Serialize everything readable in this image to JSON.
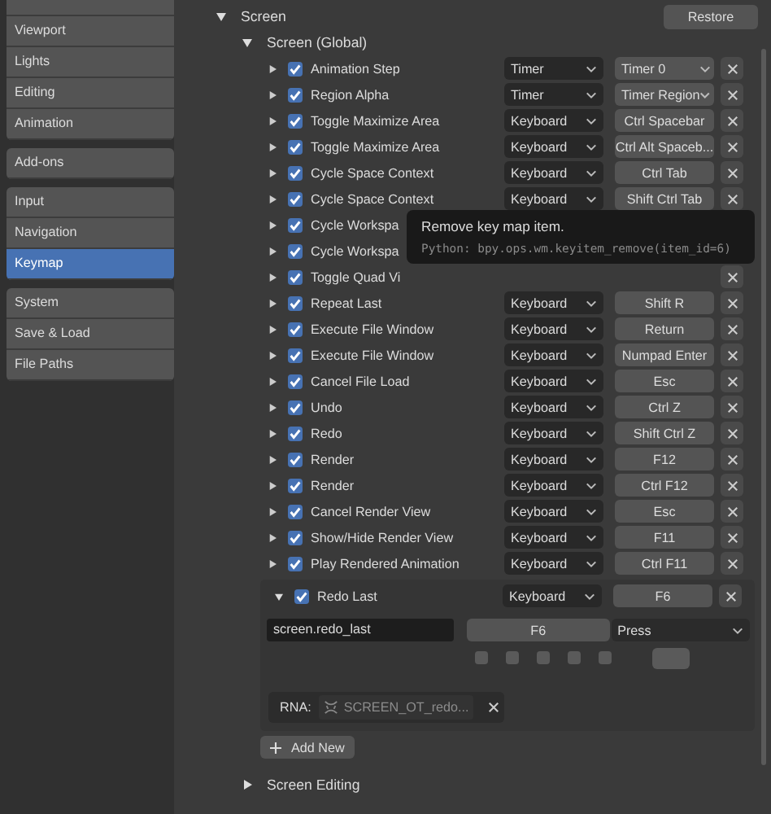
{
  "sidebar": {
    "groups": [
      [
        {
          "label": "Viewport",
          "selected": false
        },
        {
          "label": "Lights",
          "selected": false
        },
        {
          "label": "Editing",
          "selected": false
        },
        {
          "label": "Animation",
          "selected": false
        }
      ],
      [
        {
          "label": "Add-ons",
          "selected": false
        }
      ],
      [
        {
          "label": "Input",
          "selected": false
        },
        {
          "label": "Navigation",
          "selected": false
        },
        {
          "label": "Keymap",
          "selected": true
        }
      ],
      [
        {
          "label": "System",
          "selected": false
        },
        {
          "label": "Save & Load",
          "selected": false
        },
        {
          "label": "File Paths",
          "selected": false
        }
      ]
    ]
  },
  "section": {
    "title": "Screen",
    "expanded": true,
    "restore": "Restore",
    "group": {
      "title": "Screen (Global)",
      "expanded": true,
      "items": [
        {
          "name": "Animation Step",
          "checked": true,
          "type": "Timer",
          "key": "Timer 0",
          "kind": "dropdown"
        },
        {
          "name": "Region Alpha",
          "checked": true,
          "type": "Timer",
          "key": "Timer Region",
          "kind": "dropdown"
        },
        {
          "name": "Toggle Maximize Area",
          "checked": true,
          "type": "Keyboard",
          "key": "Ctrl Spacebar",
          "kind": "button"
        },
        {
          "name": "Toggle Maximize Area",
          "checked": true,
          "type": "Keyboard",
          "key": "Ctrl Alt Spaceb...",
          "kind": "button"
        },
        {
          "name": "Cycle Space Context",
          "checked": true,
          "type": "Keyboard",
          "key": "Ctrl Tab",
          "kind": "button"
        },
        {
          "name": "Cycle Space Context",
          "checked": true,
          "type": "Keyboard",
          "key": "Shift Ctrl Tab",
          "kind": "button"
        },
        {
          "name": "Cycle Workspa",
          "checked": true,
          "kind": "covered"
        },
        {
          "name": "Cycle Workspa",
          "checked": true,
          "kind": "covered"
        },
        {
          "name": "Toggle Quad Vi",
          "checked": true,
          "kind": "partial"
        },
        {
          "name": "Repeat Last",
          "checked": true,
          "type": "Keyboard",
          "key": "Shift R",
          "kind": "button"
        },
        {
          "name": "Execute File Window",
          "checked": true,
          "type": "Keyboard",
          "key": "Return",
          "kind": "button"
        },
        {
          "name": "Execute File Window",
          "checked": true,
          "type": "Keyboard",
          "key": "Numpad Enter",
          "kind": "button"
        },
        {
          "name": "Cancel File Load",
          "checked": true,
          "type": "Keyboard",
          "key": "Esc",
          "kind": "button"
        },
        {
          "name": "Undo",
          "checked": true,
          "type": "Keyboard",
          "key": "Ctrl Z",
          "kind": "button"
        },
        {
          "name": "Redo",
          "checked": true,
          "type": "Keyboard",
          "key": "Shift Ctrl Z",
          "kind": "button"
        },
        {
          "name": "Render",
          "checked": true,
          "type": "Keyboard",
          "key": "F12",
          "kind": "button"
        },
        {
          "name": "Render",
          "checked": true,
          "type": "Keyboard",
          "key": "Ctrl F12",
          "kind": "button"
        },
        {
          "name": "Cancel Render View",
          "checked": true,
          "type": "Keyboard",
          "key": "Esc",
          "kind": "button"
        },
        {
          "name": "Show/Hide Render View",
          "checked": true,
          "type": "Keyboard",
          "key": "F11",
          "kind": "button"
        },
        {
          "name": "Play Rendered Animation",
          "checked": true,
          "type": "Keyboard",
          "key": "Ctrl F11",
          "kind": "button"
        }
      ],
      "expanded_item": {
        "name": "Redo Last",
        "checked": true,
        "type": "Keyboard",
        "key": "F6",
        "operator": "screen.redo_last",
        "key_value": "F6",
        "event": "Press",
        "modifiers": [
          {
            "checked": false
          },
          {
            "checked": false
          },
          {
            "checked": false
          },
          {
            "checked": false
          },
          {
            "checked": false
          }
        ],
        "rna_label": "RNA:",
        "rna_value": "SCREEN_OT_redo..."
      },
      "add_new": "Add New"
    },
    "next_group": {
      "title": "Screen Editing",
      "expanded": false
    }
  },
  "tooltip": {
    "title": "Remove key map item.",
    "python": "Python: bpy.ops.wm.keyitem_remove(item_id=6)"
  }
}
